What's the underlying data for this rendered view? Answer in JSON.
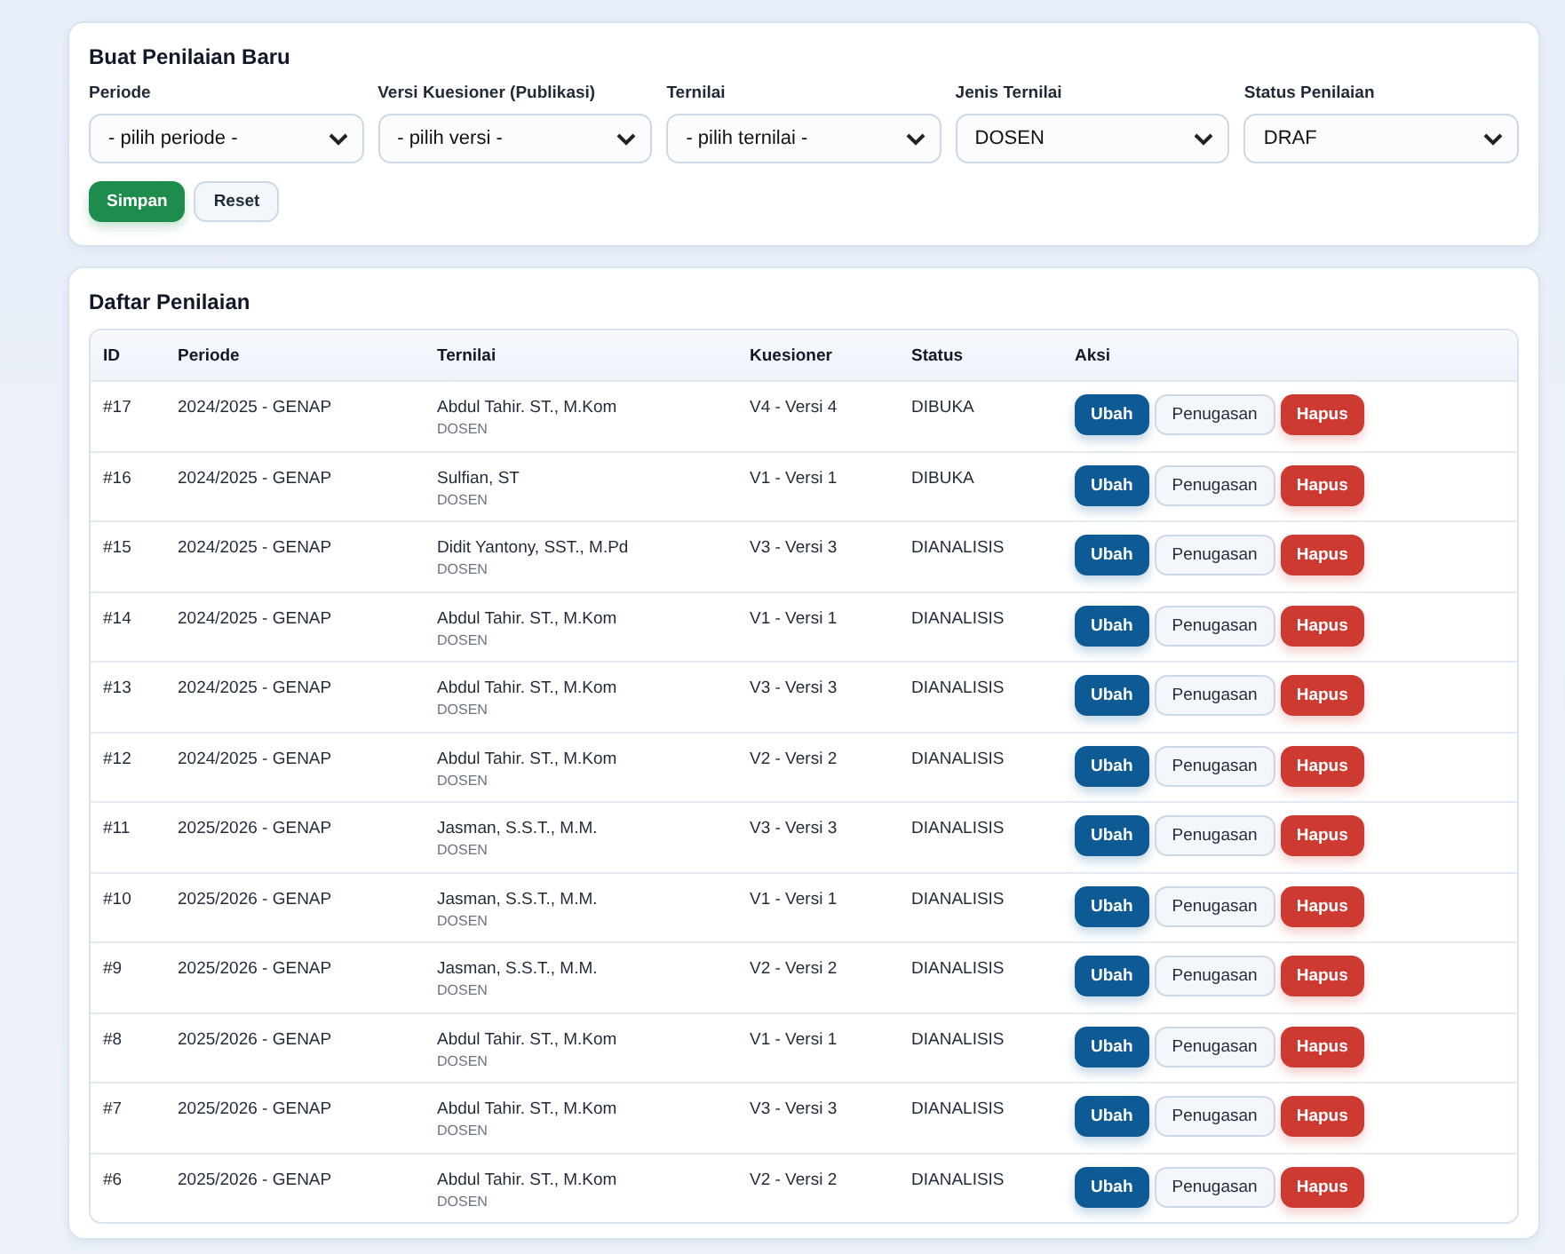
{
  "form": {
    "title": "Buat Penilaian Baru",
    "fields": [
      {
        "label": "Periode",
        "value": "- pilih periode -"
      },
      {
        "label": "Versi Kuesioner (Publikasi)",
        "value": "- pilih versi -"
      },
      {
        "label": "Ternilai",
        "value": "- pilih ternilai -"
      },
      {
        "label": "Jenis Ternilai",
        "value": "DOSEN"
      },
      {
        "label": "Status Penilaian",
        "value": "DRAF"
      }
    ],
    "buttons": [
      {
        "label": "Simpan",
        "kind": "primary"
      },
      {
        "label": "Reset",
        "kind": "secondary"
      }
    ]
  },
  "list": {
    "title": "Daftar Penilaian",
    "columns": [
      "ID",
      "Periode",
      "Ternilai",
      "Kuesioner",
      "Status",
      "Aksi"
    ],
    "rows": [
      {
        "id": "#17",
        "periode": "2024/2025 - GENAP",
        "name": "Abdul Tahir. ST., M.Kom",
        "type": "DOSEN",
        "kuesioner": "V4 - Versi 4",
        "status": "DIBUKA",
        "actions": [
          {
            "label": "Ubah",
            "kind": "edit"
          },
          {
            "label": "Penugasan",
            "kind": "assign"
          },
          {
            "label": "Hapus",
            "kind": "delete"
          }
        ]
      },
      {
        "id": "#16",
        "periode": "2024/2025 - GENAP",
        "name": "Sulfian, ST",
        "type": "DOSEN",
        "kuesioner": "V1 - Versi 1",
        "status": "DIBUKA",
        "actions": [
          {
            "label": "Ubah",
            "kind": "edit"
          },
          {
            "label": "Penugasan",
            "kind": "assign"
          },
          {
            "label": "Hapus",
            "kind": "delete"
          }
        ]
      },
      {
        "id": "#15",
        "periode": "2024/2025 - GENAP",
        "name": "Didit Yantony, SST., M.Pd",
        "type": "DOSEN",
        "kuesioner": "V3 - Versi 3",
        "status": "DIANALISIS",
        "actions": [
          {
            "label": "Ubah",
            "kind": "edit"
          },
          {
            "label": "Penugasan",
            "kind": "assign"
          },
          {
            "label": "Hapus",
            "kind": "delete"
          }
        ]
      },
      {
        "id": "#14",
        "periode": "2024/2025 - GENAP",
        "name": "Abdul Tahir. ST., M.Kom",
        "type": "DOSEN",
        "kuesioner": "V1 - Versi 1",
        "status": "DIANALISIS",
        "actions": [
          {
            "label": "Ubah",
            "kind": "edit"
          },
          {
            "label": "Penugasan",
            "kind": "assign"
          },
          {
            "label": "Hapus",
            "kind": "delete"
          }
        ]
      },
      {
        "id": "#13",
        "periode": "2024/2025 - GENAP",
        "name": "Abdul Tahir. ST., M.Kom",
        "type": "DOSEN",
        "kuesioner": "V3 - Versi 3",
        "status": "DIANALISIS",
        "actions": [
          {
            "label": "Ubah",
            "kind": "edit"
          },
          {
            "label": "Penugasan",
            "kind": "assign"
          },
          {
            "label": "Hapus",
            "kind": "delete"
          }
        ]
      },
      {
        "id": "#12",
        "periode": "2024/2025 - GENAP",
        "name": "Abdul Tahir. ST., M.Kom",
        "type": "DOSEN",
        "kuesioner": "V2 - Versi 2",
        "status": "DIANALISIS",
        "actions": [
          {
            "label": "Ubah",
            "kind": "edit"
          },
          {
            "label": "Penugasan",
            "kind": "assign"
          },
          {
            "label": "Hapus",
            "kind": "delete"
          }
        ]
      },
      {
        "id": "#11",
        "periode": "2025/2026 - GENAP",
        "name": "Jasman, S.S.T., M.M.",
        "type": "DOSEN",
        "kuesioner": "V3 - Versi 3",
        "status": "DIANALISIS",
        "actions": [
          {
            "label": "Ubah",
            "kind": "edit"
          },
          {
            "label": "Penugasan",
            "kind": "assign"
          },
          {
            "label": "Hapus",
            "kind": "delete"
          }
        ]
      },
      {
        "id": "#10",
        "periode": "2025/2026 - GENAP",
        "name": "Jasman, S.S.T., M.M.",
        "type": "DOSEN",
        "kuesioner": "V1 - Versi 1",
        "status": "DIANALISIS",
        "actions": [
          {
            "label": "Ubah",
            "kind": "edit"
          },
          {
            "label": "Penugasan",
            "kind": "assign"
          },
          {
            "label": "Hapus",
            "kind": "delete"
          }
        ]
      },
      {
        "id": "#9",
        "periode": "2025/2026 - GENAP",
        "name": "Jasman, S.S.T., M.M.",
        "type": "DOSEN",
        "kuesioner": "V2 - Versi 2",
        "status": "DIANALISIS",
        "actions": [
          {
            "label": "Ubah",
            "kind": "edit"
          },
          {
            "label": "Penugasan",
            "kind": "assign"
          },
          {
            "label": "Hapus",
            "kind": "delete"
          }
        ]
      },
      {
        "id": "#8",
        "periode": "2025/2026 - GENAP",
        "name": "Abdul Tahir. ST., M.Kom",
        "type": "DOSEN",
        "kuesioner": "V1 - Versi 1",
        "status": "DIANALISIS",
        "actions": [
          {
            "label": "Ubah",
            "kind": "edit"
          },
          {
            "label": "Penugasan",
            "kind": "assign"
          },
          {
            "label": "Hapus",
            "kind": "delete"
          }
        ]
      },
      {
        "id": "#7",
        "periode": "2025/2026 - GENAP",
        "name": "Abdul Tahir. ST., M.Kom",
        "type": "DOSEN",
        "kuesioner": "V3 - Versi 3",
        "status": "DIANALISIS",
        "actions": [
          {
            "label": "Ubah",
            "kind": "edit"
          },
          {
            "label": "Penugasan",
            "kind": "assign"
          },
          {
            "label": "Hapus",
            "kind": "delete"
          }
        ]
      },
      {
        "id": "#6",
        "periode": "2025/2026 - GENAP",
        "name": "Abdul Tahir. ST., M.Kom",
        "type": "DOSEN",
        "kuesioner": "V2 - Versi 2",
        "status": "DIANALISIS",
        "actions": [
          {
            "label": "Ubah",
            "kind": "edit"
          },
          {
            "label": "Penugasan",
            "kind": "assign"
          },
          {
            "label": "Hapus",
            "kind": "delete"
          }
        ]
      }
    ]
  }
}
